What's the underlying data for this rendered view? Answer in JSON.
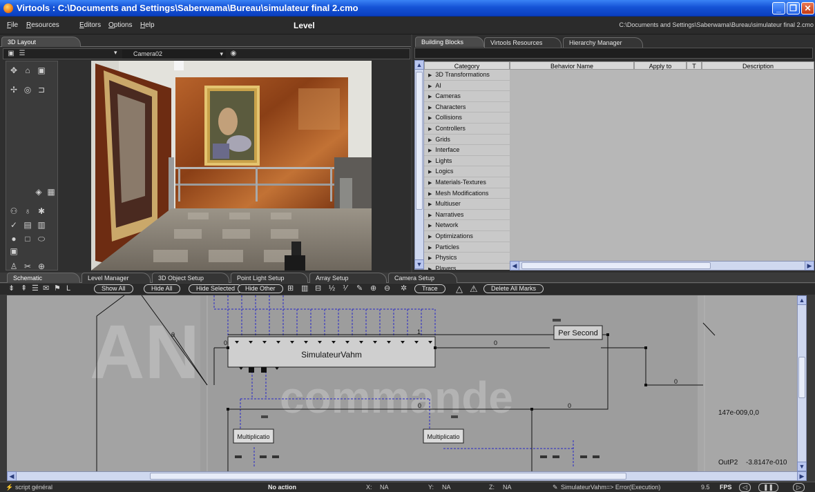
{
  "window": {
    "title": "Virtools : C:\\Documents and Settings\\Saberwama\\Bureau\\simulateur final 2.cmo",
    "min_glyph": "_",
    "max_glyph": "❐",
    "close_glyph": "✕"
  },
  "menu": {
    "items": [
      "File",
      "Resources",
      "Editors",
      "Options",
      "Help"
    ],
    "level": "Level",
    "path": "C:\\Documents and Settings\\Saberwama\\Bureau\\simulateur final 2.cmo"
  },
  "layout_panel": {
    "tab": "3D Layout",
    "camera": "Camera02"
  },
  "building_blocks": {
    "tabs": [
      "Building Blocks",
      "Virtools Resources",
      "Hierarchy Manager"
    ],
    "category_header": "Category",
    "columns": [
      "Behavior Name",
      "Apply to",
      "T",
      "Description"
    ],
    "categories": [
      "3D Transformations",
      "AI",
      "Cameras",
      "Characters",
      "Collisions",
      "Controllers",
      "Grids",
      "Interface",
      "Lights",
      "Logics",
      "Materials-Textures",
      "Mesh Modifications",
      "Multiuser",
      "Narratives",
      "Network",
      "Optimizations",
      "Particles",
      "Physics",
      "Players"
    ]
  },
  "bottom_tabs": [
    "Schematic",
    "Level Manager",
    "3D Object Setup",
    "Point Light Setup",
    "Array Setup",
    "Camera Setup"
  ],
  "schematic_toolbar": {
    "show_all": "Show All",
    "hide_all": "Hide All",
    "hide_selected": "Hide Selected",
    "hide_other": "Hide Other",
    "trace": "Trace",
    "delete_marks": "Delete All Marks"
  },
  "schematic": {
    "watermark_a": "AN",
    "watermark_b": "commande",
    "main_block": "SimulateurVahm",
    "per_second": "Per Second",
    "mult_1": "Multiplicatio",
    "mult_2": "Multiplicatio",
    "values": [
      "0",
      "0",
      "0",
      "0",
      "0",
      "0",
      "1"
    ],
    "readout_1": "147e-009,0,0",
    "readout_2_label": "OutP2",
    "readout_2_value": "-3.8147e-010"
  },
  "status": {
    "script": "script général",
    "action": "No action",
    "x_label": "X:",
    "x_value": "NA",
    "y_label": "Y:",
    "y_value": "NA",
    "z_label": "Z:",
    "z_value": "NA",
    "message": "SimulateurVahm=> Error(Execution)",
    "fps_value": "9.5",
    "fps_label": "FPS"
  }
}
